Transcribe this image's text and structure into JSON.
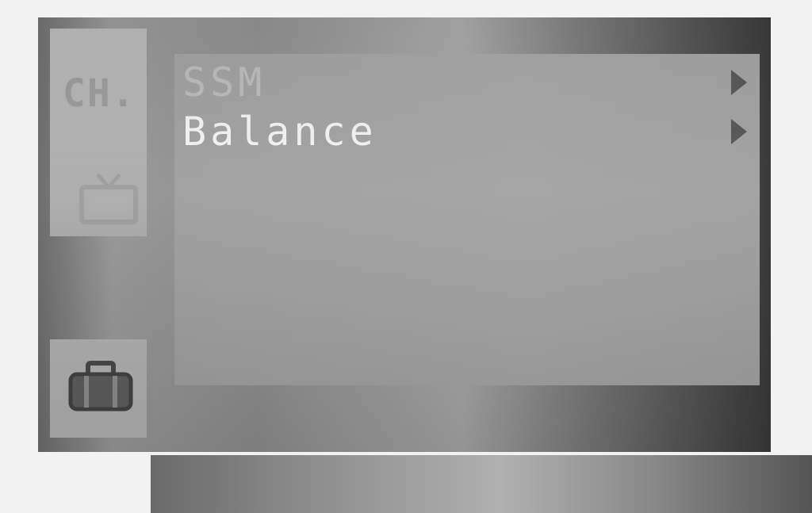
{
  "sidebar": {
    "channel_tab": {
      "label": "CH.",
      "icon": "tv-icon"
    },
    "tools_tab": {
      "icon": "toolbox-icon"
    }
  },
  "menu": {
    "items": [
      {
        "label": "SSM",
        "state": "dimmed",
        "icon": "chevron-right-icon"
      },
      {
        "label": "Balance",
        "state": "active",
        "icon": "chevron-right-icon"
      }
    ]
  },
  "colors": {
    "frame": "#8f8f8f",
    "panel": "#a6a6a6",
    "active_text": "#f3f3f3",
    "dimmed_text": "#bcbcbc",
    "arrow": "#5a5a5a"
  }
}
